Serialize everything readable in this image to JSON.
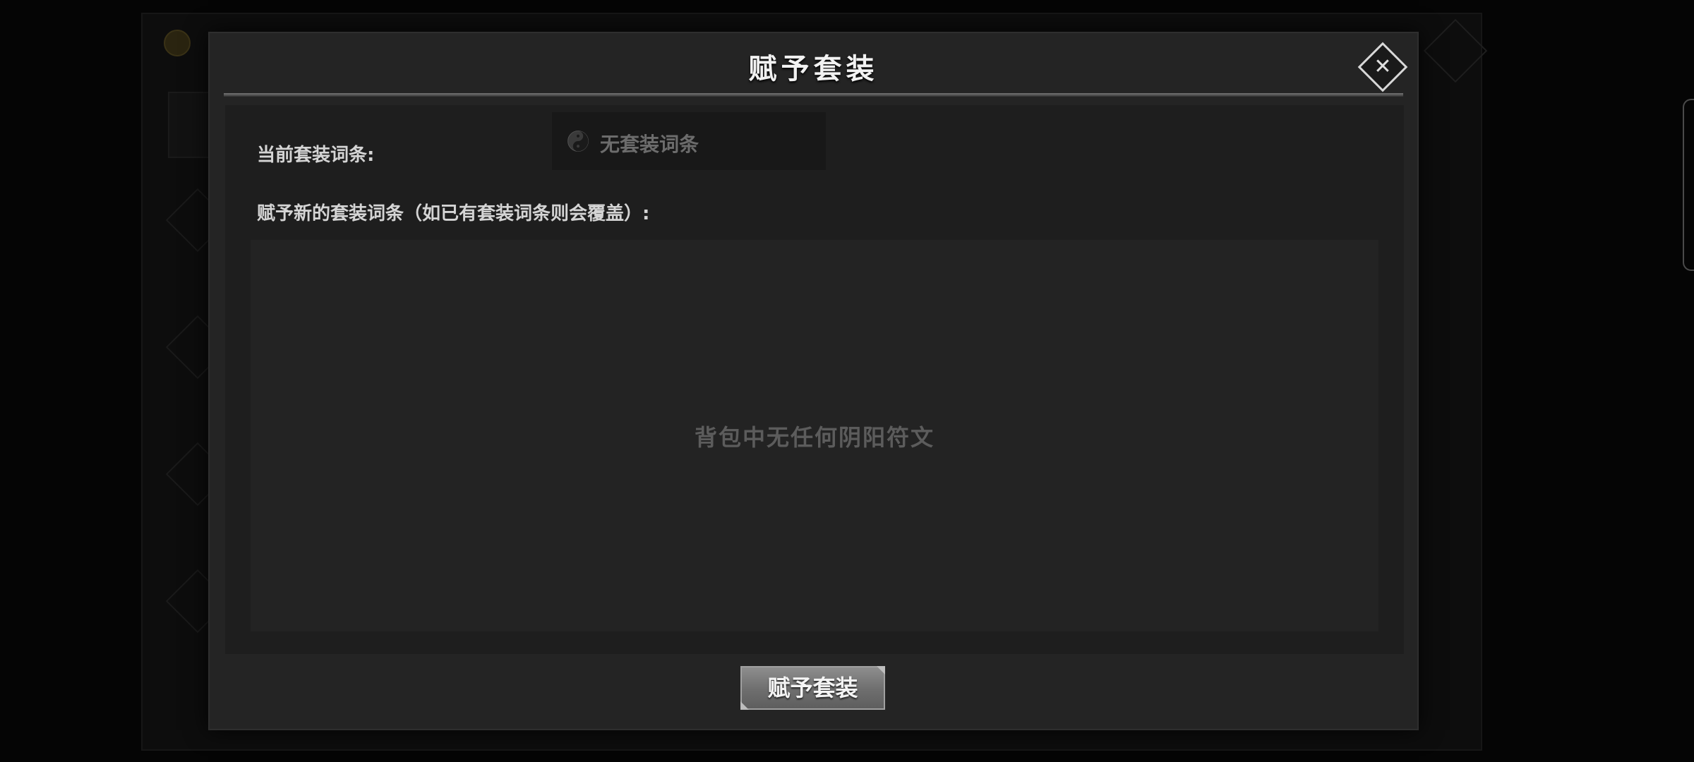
{
  "modal": {
    "title": "赋予套装",
    "close_icon": "close-icon"
  },
  "current_set": {
    "label": "当前套装词条:",
    "icon": "yinyang-icon",
    "value": "无套装词条"
  },
  "new_set": {
    "label": "赋予新的套装词条（如已有套装词条则会覆盖）:",
    "empty_message": "背包中无任何阴阳符文"
  },
  "actions": {
    "confirm_label": "赋予套装"
  },
  "colors": {
    "modal_bg": "#242424",
    "section_bg": "#1e1e1e",
    "button_bg": "#7a7a7a",
    "title_text": "#f2f2f2",
    "muted_text": "#5c5c5c"
  }
}
